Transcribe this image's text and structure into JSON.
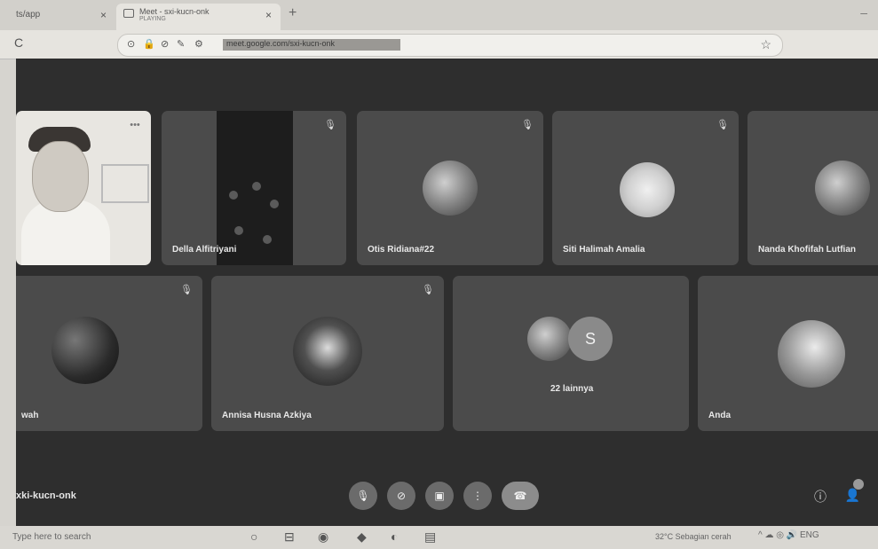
{
  "browser": {
    "tab1_label": "ts/app",
    "tab2_label": "Meet - sxi-kucn-onk",
    "tab2_sub": "PLAYING",
    "tab_close": "×",
    "new_tab": "+",
    "reload": "C",
    "url": "meet.google.com/sxi-kucn-onk",
    "star": "☆"
  },
  "participants_row1": [
    {
      "name": ""
    },
    {
      "name": "Della Alfitriyani"
    },
    {
      "name": "Otis Ridiana#22"
    },
    {
      "name": "Siti Halimah Amalia"
    },
    {
      "name": "Nanda Khofifah Lutfian"
    }
  ],
  "participants_row2": [
    {
      "name": "wah"
    },
    {
      "name": "Annisa Husna Azkiya"
    },
    {
      "name": "22 lainnya",
      "initial": "S"
    },
    {
      "name": "Anda"
    }
  ],
  "meeting": {
    "code": "xki-kucn-onk",
    "icons": {
      "mic": "🎙",
      "camera": "⊘",
      "present": "▣",
      "more": "⋮",
      "end_call": "☎",
      "info": "ⓘ",
      "people": "👤"
    }
  },
  "taskbar": {
    "search_placeholder": "Type here to search",
    "weather": "32°C  Sebagian cerah",
    "tray": "^  ☁  ◎  🔊  ENG"
  }
}
